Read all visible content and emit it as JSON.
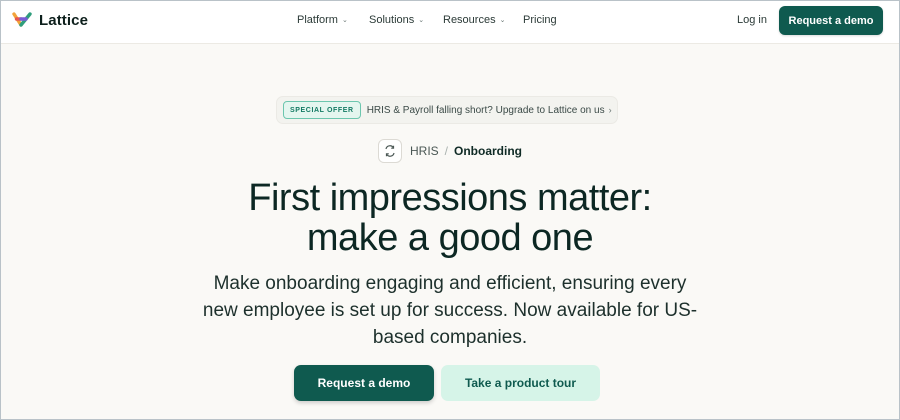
{
  "nav": {
    "logo_text": "Lattice",
    "menu": [
      {
        "label": "Platform",
        "has_dropdown": true
      },
      {
        "label": "Solutions",
        "has_dropdown": true
      },
      {
        "label": "Resources",
        "has_dropdown": true
      },
      {
        "label": "Pricing",
        "has_dropdown": false
      }
    ],
    "login_label": "Log in",
    "demo_label": "Request a demo"
  },
  "offer": {
    "badge": "SPECIAL OFFER",
    "text": "HRIS & Payroll falling short? Upgrade to Lattice on us"
  },
  "breadcrumb": {
    "parent": "HRIS",
    "separator": "/",
    "current": "Onboarding"
  },
  "hero": {
    "title_line1": "First impressions matter:",
    "title_line2": "make a good one",
    "subtitle": "Make onboarding engaging and efficient, ensuring every new employee is set up for success. Now available for US-based companies."
  },
  "cta": {
    "primary": "Request a demo",
    "secondary": "Take a product tour"
  },
  "colors": {
    "brand_dark_green": "#0f5a4f",
    "mint": "#d6f4e8",
    "background": "#faf9f6",
    "text_dark": "#0c2723"
  },
  "icons": {
    "logo": "lattice-logo-icon",
    "breadcrumb": "onboarding-sync-icon",
    "dropdown": "chevron-down-icon",
    "offer_arrow": "chevron-right-icon"
  }
}
